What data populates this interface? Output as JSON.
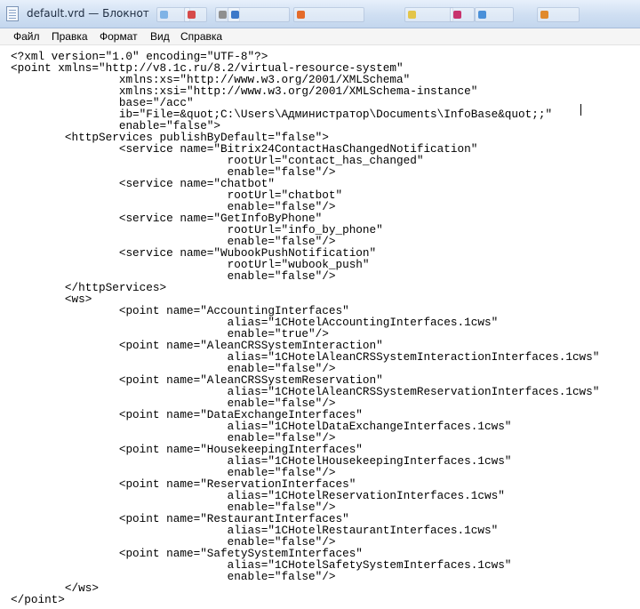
{
  "window": {
    "title": "default.vrd — Блокнот"
  },
  "taskbar_ghosts": [
    {
      "color": "#7fb3e6"
    },
    {
      "color": "#d64a4a"
    },
    {
      "color": "#8f8f8f"
    },
    {
      "color": "#3b78c9"
    },
    {
      "color": "#e46b2a"
    },
    {
      "color": "#e3c54a"
    },
    {
      "color": "#c8336d"
    },
    {
      "color": "#4a90d9"
    },
    {
      "color": "#e08a2c"
    }
  ],
  "menu": {
    "file": "Файл",
    "edit": "Правка",
    "format": "Формат",
    "view": "Вид",
    "help": "Справка"
  },
  "document": {
    "lines": [
      "<?xml version=\"1.0\" encoding=\"UTF-8\"?>",
      "<point xmlns=\"http://v8.1c.ru/8.2/virtual-resource-system\"",
      "\t\txmlns:xs=\"http://www.w3.org/2001/XMLSchema\"",
      "\t\txmlns:xsi=\"http://www.w3.org/2001/XMLSchema-instance\"",
      "\t\tbase=\"/acc\"",
      "\t\tib=\"File=&quot;C:\\Users\\Администратор\\Documents\\InfoBase&quot;;\"",
      "\t\tenable=\"false\">",
      "\t<httpServices publishByDefault=\"false\">",
      "\t\t<service name=\"Bitrix24ContactHasChangedNotification\"",
      "\t\t\t\trootUrl=\"contact_has_changed\"",
      "\t\t\t\tenable=\"false\"/>",
      "\t\t<service name=\"chatbot\"",
      "\t\t\t\trootUrl=\"chatbot\"",
      "\t\t\t\tenable=\"false\"/>",
      "\t\t<service name=\"GetInfoByPhone\"",
      "\t\t\t\trootUrl=\"info_by_phone\"",
      "\t\t\t\tenable=\"false\"/>",
      "\t\t<service name=\"WubookPushNotification\"",
      "\t\t\t\trootUrl=\"wubook_push\"",
      "\t\t\t\tenable=\"false\"/>",
      "\t</httpServices>",
      "\t<ws>",
      "\t\t<point name=\"AccountingInterfaces\"",
      "\t\t\t\talias=\"1CHotelAccountingInterfaces.1cws\"",
      "\t\t\t\tenable=\"true\"/>",
      "\t\t<point name=\"AleanCRSSystemInteraction\"",
      "\t\t\t\talias=\"1CHotelAleanCRSSystemInteractionInterfaces.1cws\"",
      "\t\t\t\tenable=\"false\"/>",
      "\t\t<point name=\"AleanCRSSystemReservation\"",
      "\t\t\t\talias=\"1CHotelAleanCRSSystemReservationInterfaces.1cws\"",
      "\t\t\t\tenable=\"false\"/>",
      "\t\t<point name=\"DataExchangeInterfaces\"",
      "\t\t\t\talias=\"1CHotelDataExchangeInterfaces.1cws\"",
      "\t\t\t\tenable=\"false\"/>",
      "\t\t<point name=\"HousekeepingInterfaces\"",
      "\t\t\t\talias=\"1CHotelHousekeepingInterfaces.1cws\"",
      "\t\t\t\tenable=\"false\"/>",
      "\t\t<point name=\"ReservationInterfaces\"",
      "\t\t\t\talias=\"1CHotelReservationInterfaces.1cws\"",
      "\t\t\t\tenable=\"false\"/>",
      "\t\t<point name=\"RestaurantInterfaces\"",
      "\t\t\t\talias=\"1CHotelRestaurantInterfaces.1cws\"",
      "\t\t\t\tenable=\"false\"/>",
      "\t\t<point name=\"SafetySystemInterfaces\"",
      "\t\t\t\talias=\"1CHotelSafetySystemInterfaces.1cws\"",
      "\t\t\t\tenable=\"false\"/>",
      "\t</ws>",
      "</point>"
    ]
  }
}
